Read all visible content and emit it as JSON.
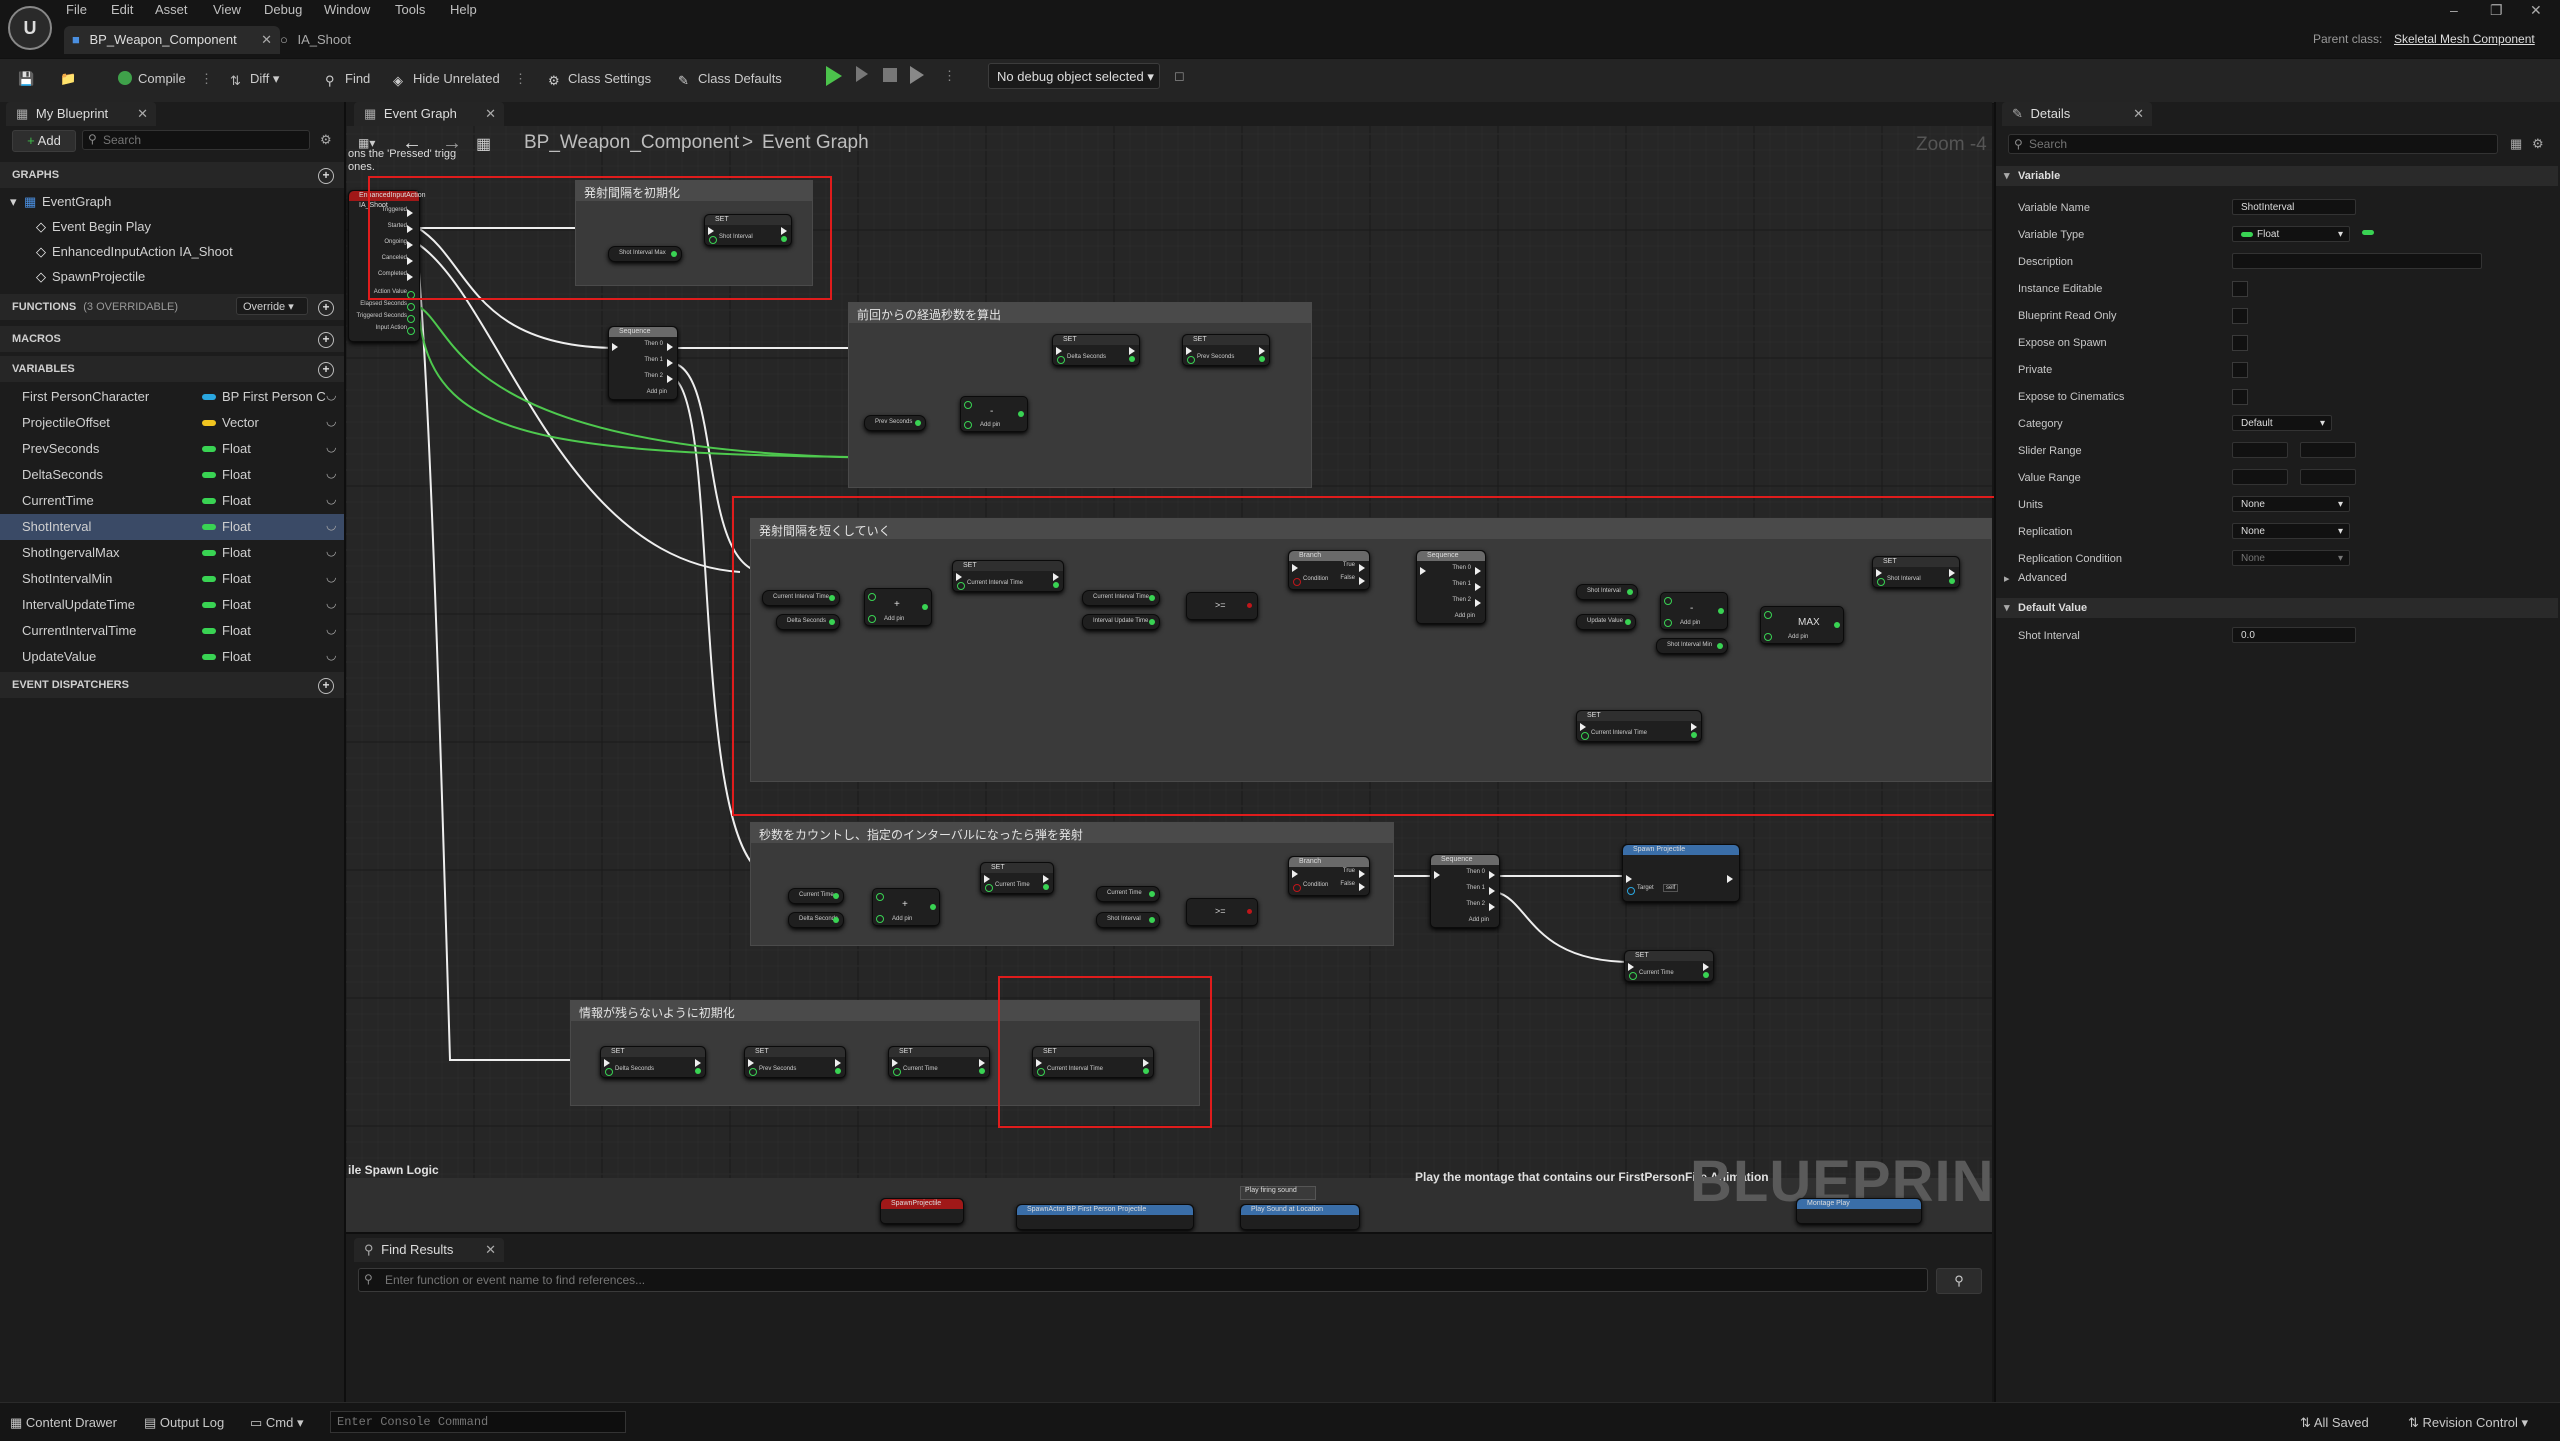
{
  "menus": [
    "File",
    "Edit",
    "Asset",
    "View",
    "Debug",
    "Window",
    "Tools",
    "Help"
  ],
  "doc_tabs": [
    {
      "label": "BP_Weapon_Component"
    },
    {
      "label": "IA_Shoot"
    }
  ],
  "parent_class": {
    "label": "Parent class:",
    "value": "Skeletal Mesh Component"
  },
  "toolbar": {
    "compile": "Compile",
    "diff": "Diff",
    "find": "Find",
    "hide_unrelated": "Hide Unrelated",
    "class_settings": "Class Settings",
    "class_defaults": "Class Defaults",
    "debug_object": "No debug object selected"
  },
  "left_panel": {
    "tab": "My Blueprint",
    "add": "Add",
    "search_placeholder": "Search",
    "graphs_header": "GRAPHS",
    "graphs": [
      "EventGraph",
      "Event Begin Play",
      "EnhancedInputAction IA_Shoot",
      "SpawnProjectile"
    ],
    "functions_header": "FUNCTIONS",
    "functions_count": "(3 OVERRIDABLE)",
    "override": "Override",
    "macros_header": "MACROS",
    "variables_header": "VARIABLES",
    "variables": [
      {
        "name": "First PersonCharacter",
        "type": "BP First Person C",
        "color": "#2aa7e0"
      },
      {
        "name": "ProjectileOffset",
        "type": "Vector",
        "color": "#f0c420"
      },
      {
        "name": "PrevSeconds",
        "type": "Float",
        "color": "#39d353"
      },
      {
        "name": "DeltaSeconds",
        "type": "Float",
        "color": "#39d353"
      },
      {
        "name": "CurrentTime",
        "type": "Float",
        "color": "#39d353"
      },
      {
        "name": "ShotInterval",
        "type": "Float",
        "color": "#39d353"
      },
      {
        "name": "ShotIngervalMax",
        "type": "Float",
        "color": "#39d353"
      },
      {
        "name": "ShotIntervalMin",
        "type": "Float",
        "color": "#39d353"
      },
      {
        "name": "IntervalUpdateTime",
        "type": "Float",
        "color": "#39d353"
      },
      {
        "name": "CurrentIntervalTime",
        "type": "Float",
        "color": "#39d353"
      },
      {
        "name": "UpdateValue",
        "type": "Float",
        "color": "#39d353"
      }
    ],
    "selected_variable": "ShotInterval",
    "dispatchers_header": "EVENT DISPATCHERS"
  },
  "graph": {
    "tab": "Event Graph",
    "breadcrumb_root": "BP_Weapon_Component",
    "breadcrumb_sep": ">",
    "breadcrumb_leaf": "Event Graph",
    "zoom": "Zoom -4",
    "watermark": "BLUEPRINT",
    "input_fragment": "ons the 'Pressed' trigg",
    "input_fragment2": "ones.",
    "event_title": "EnhancedInputAction IA_Shoot",
    "event_pins": [
      "Triggered",
      "Started",
      "Ongoing",
      "Canceled",
      "Completed",
      "Action Value",
      "Elapsed Seconds",
      "Triggered Seconds",
      "Input Action"
    ],
    "comments": [
      {
        "title": "発射間隔を初期化"
      },
      {
        "title": "前回からの経過秒数を算出"
      },
      {
        "title": "発射間隔を短くしていく"
      },
      {
        "title": "秒数をカウントし、指定のインターバルになったら弾を発射"
      },
      {
        "title": "情報が残らないように初期化"
      }
    ],
    "spawn_logic_label": "ile Spawn Logic",
    "montage_label": "Play the montage that contains our FirstPersonFire Animation",
    "bottom_nodes": [
      "SpawnProjectile",
      "SpawnActor BP First Person Projectile",
      "Play Sound at Location",
      "Play firing sound",
      "Montage Play"
    ],
    "node_labels": {
      "set": "SET",
      "sequence": "Sequence",
      "branch": "Branch",
      "then0": "Then 0",
      "then1": "Then 1",
      "then2": "Then 2",
      "add_pin": "Add pin",
      "condition": "Condition",
      "true": "True",
      "false": "False",
      "max": "MAX",
      "spawn_projectile": "Spawn Projectile",
      "target": "Target",
      "self": "self",
      "shot_interval": "Shot Interval",
      "shot_interval_max": "Shot Interval Max",
      "shot_interval_min": "Shot Interval Min",
      "prev_seconds": "Prev Seconds",
      "delta_seconds": "Delta Seconds",
      "current_time": "Current Time",
      "current_interval_time": "Current Interval Time",
      "interval_update_time": "Interval Update Time",
      "update_value": "Update Value",
      "value_zero": "0.0",
      "ge": ">=",
      "minus": "-",
      "plus": "+"
    }
  },
  "find_panel": {
    "tab": "Find Results",
    "placeholder": "Enter function or event name to find references..."
  },
  "details": {
    "tab": "Details",
    "search_placeholder": "Search",
    "variable_section": "Variable",
    "rows": [
      {
        "label": "Variable Name",
        "value": "ShotInterval"
      },
      {
        "label": "Variable Type",
        "value": "Float"
      },
      {
        "label": "Description",
        "value": ""
      },
      {
        "label": "Instance Editable"
      },
      {
        "label": "Blueprint Read Only"
      },
      {
        "label": "Expose on Spawn"
      },
      {
        "label": "Private"
      },
      {
        "label": "Expose to Cinematics"
      },
      {
        "label": "Category",
        "value": "Default"
      },
      {
        "label": "Slider Range",
        "value": ""
      },
      {
        "label": "Value Range",
        "value": ""
      },
      {
        "label": "Units",
        "value": "None"
      },
      {
        "label": "Replication",
        "value": "None"
      },
      {
        "label": "Replication Condition",
        "value": "None"
      }
    ],
    "advanced": "Advanced",
    "default_value_section": "Default Value",
    "shot_interval_label": "Shot Interval",
    "shot_interval_value": "0.0"
  },
  "statusbar": {
    "content_drawer": "Content Drawer",
    "output_log": "Output Log",
    "cmd": "Cmd",
    "console_placeholder": "Enter Console Command",
    "all_saved": "All Saved",
    "revision_control": "Revision Control"
  }
}
